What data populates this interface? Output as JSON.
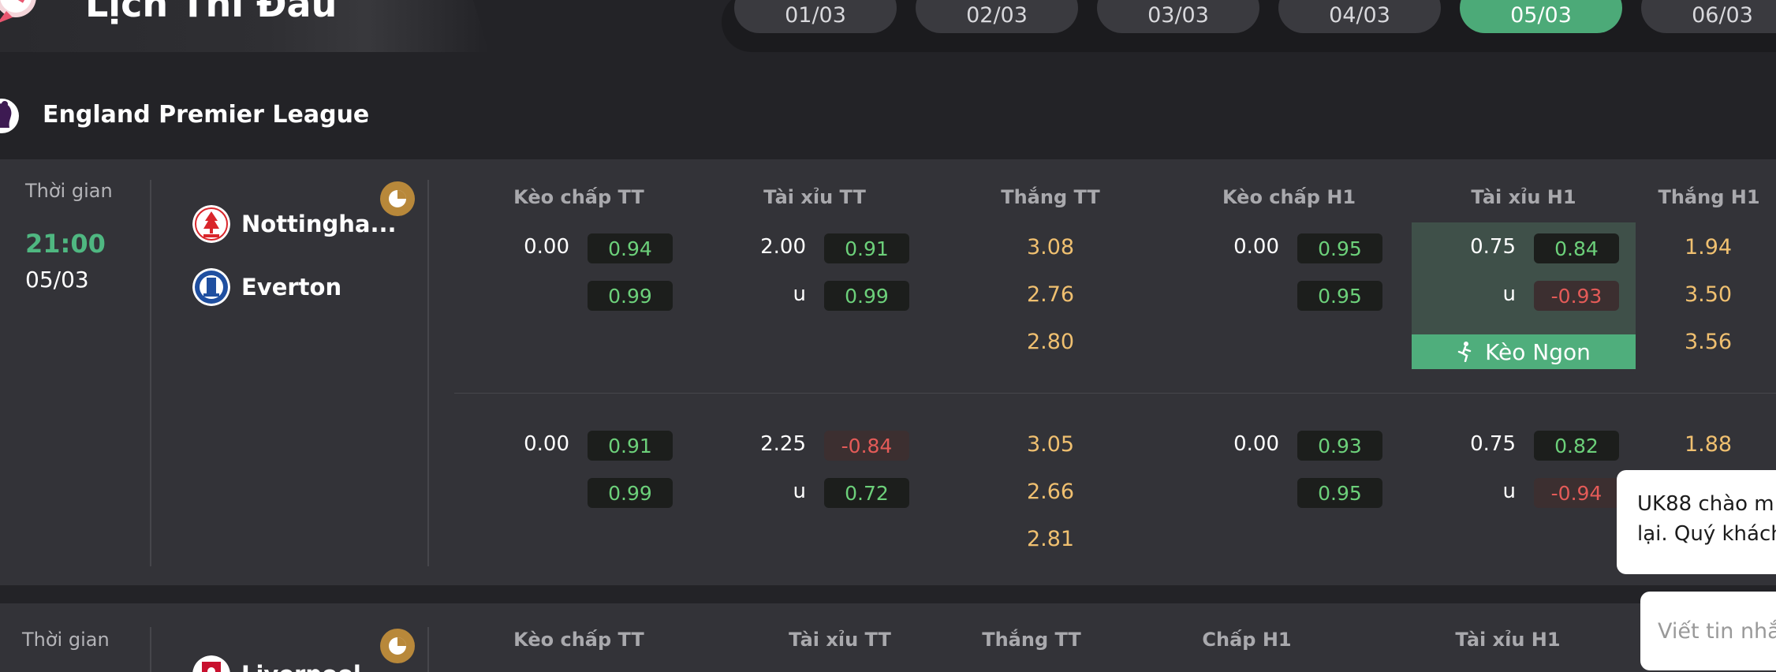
{
  "header": {
    "title": "Lịch Thi Đấu",
    "dates": [
      {
        "label": "01/03",
        "active": false
      },
      {
        "label": "02/03",
        "active": false
      },
      {
        "label": "03/03",
        "active": false
      },
      {
        "label": "04/03",
        "active": false
      },
      {
        "label": "05/03",
        "active": true
      },
      {
        "label": "06/03",
        "active": false
      }
    ]
  },
  "league": {
    "name": "England Premier League",
    "icon": "premier-league-lion-icon"
  },
  "match1": {
    "time_label": "Thời gian",
    "time": "21:00",
    "date": "05/03",
    "home": {
      "name": "Nottingha...",
      "icon": "nottingham-forest-crest-icon"
    },
    "away": {
      "name": "Everton",
      "icon": "everton-crest-icon"
    },
    "columns": [
      "Kèo chấp TT",
      "Tài xỉu TT",
      "Thắng TT",
      "Kèo chấp H1",
      "Tài xỉu H1",
      "Thắng H1"
    ],
    "row1": {
      "hdp_line": "0.00",
      "hdp_odds": [
        "0.94",
        "0.99"
      ],
      "ou_line": "2.00",
      "ou_under": "u",
      "ou_odds": [
        "0.91",
        "0.99"
      ],
      "win": [
        "3.08",
        "2.76",
        "2.80"
      ],
      "h1_hdp_line": "0.00",
      "h1_hdp_odds": [
        "0.95",
        "0.95"
      ],
      "h1_ou_line": "0.75",
      "h1_ou_under": "u",
      "h1_ou_odds": [
        "0.84",
        "-0.93"
      ],
      "h1_win": [
        "1.94",
        "3.50",
        "3.56"
      ],
      "keo_ngon": "Kèo Ngon"
    },
    "row2": {
      "hdp_line": "0.00",
      "hdp_odds": [
        "0.91",
        "0.99"
      ],
      "ou_line": "2.25",
      "ou_under": "u",
      "ou_odds": [
        "-0.84",
        "0.72"
      ],
      "win": [
        "3.05",
        "2.66",
        "2.81"
      ],
      "h1_hdp_line": "0.00",
      "h1_hdp_odds": [
        "0.93",
        "0.95"
      ],
      "h1_ou_line": "0.75",
      "h1_ou_under": "u",
      "h1_ou_odds": [
        "0.82",
        "-0.94"
      ],
      "h1_win": [
        "1.88"
      ]
    }
  },
  "match2": {
    "time_label": "Thời gian",
    "home_partial": "Liverpool",
    "columns": [
      "Kèo chấp TT",
      "Tài xỉu TT",
      "Thắng TT",
      "Chấp H1",
      "Tài xỉu H1"
    ]
  },
  "chat": {
    "greeting_line1": "UK88 chào m",
    "greeting_line2": "lại. Quý khách",
    "input_placeholder": "Viết tin nhắ"
  },
  "colors": {
    "background": "#232327",
    "card": "#333338",
    "accent_green": "#4caa78",
    "odds_positive": "#6cd07a",
    "odds_negative": "#e45b58",
    "win_odds": "#f0c070",
    "stats_icon": "#b8883a"
  }
}
